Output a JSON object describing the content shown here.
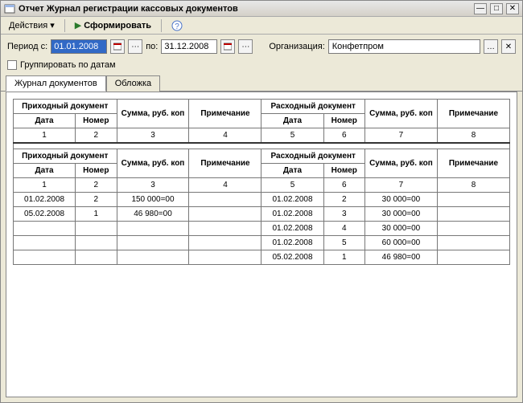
{
  "window": {
    "title": "Отчет Журнал регистрации кассовых документов"
  },
  "toolbar": {
    "actions_label": "Действия",
    "form_label": "Сформировать"
  },
  "filters": {
    "period_label": "Период с:",
    "date_from": "01.01.2008",
    "to_label": "по:",
    "date_to": "31.12.2008",
    "org_label": "Организация:",
    "org_value": "Конфетпром"
  },
  "group_by_date_label": "Группировать по датам",
  "group_by_date_checked": false,
  "tabs": {
    "journal": "Журнал документов",
    "cover": "Обложка"
  },
  "headers": {
    "incoming_doc": "Приходный документ",
    "outgoing_doc": "Расходный документ",
    "date": "Дата",
    "number": "Номер",
    "amount": "Сумма, руб. коп",
    "note": "Примечание",
    "colnums": [
      "1",
      "2",
      "3",
      "4",
      "5",
      "6",
      "7",
      "8"
    ]
  },
  "rows": [
    {
      "in_date": "01.02.2008",
      "in_num": "2",
      "in_sum": "150 000=00",
      "note1": "",
      "out_date": "01.02.2008",
      "out_num": "2",
      "out_sum": "30 000=00",
      "note2": ""
    },
    {
      "in_date": "05.02.2008",
      "in_num": "1",
      "in_sum": "46 980=00",
      "note1": "",
      "out_date": "01.02.2008",
      "out_num": "3",
      "out_sum": "30 000=00",
      "note2": ""
    },
    {
      "in_date": "",
      "in_num": "",
      "in_sum": "",
      "note1": "",
      "out_date": "01.02.2008",
      "out_num": "4",
      "out_sum": "30 000=00",
      "note2": ""
    },
    {
      "in_date": "",
      "in_num": "",
      "in_sum": "",
      "note1": "",
      "out_date": "01.02.2008",
      "out_num": "5",
      "out_sum": "60 000=00",
      "note2": ""
    },
    {
      "in_date": "",
      "in_num": "",
      "in_sum": "",
      "note1": "",
      "out_date": "05.02.2008",
      "out_num": "1",
      "out_sum": "46 980=00",
      "note2": ""
    }
  ]
}
